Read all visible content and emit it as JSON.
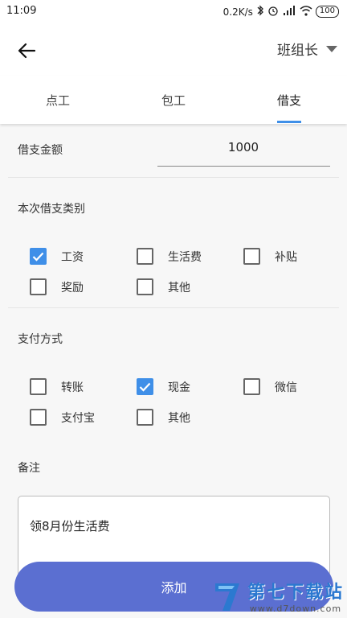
{
  "status_bar": {
    "time": "11:09",
    "network_speed": "0.2K/s",
    "battery": "100"
  },
  "header": {
    "role": "班组长"
  },
  "tabs": [
    {
      "label": "点工",
      "active": false
    },
    {
      "label": "包工",
      "active": false
    },
    {
      "label": "借支",
      "active": true
    }
  ],
  "amount": {
    "label": "借支金额",
    "value": "1000"
  },
  "loan_type": {
    "label": "本次借支类别",
    "options": [
      {
        "label": "工资",
        "checked": true
      },
      {
        "label": "生活费",
        "checked": false
      },
      {
        "label": "补贴",
        "checked": false
      },
      {
        "label": "奖励",
        "checked": false
      },
      {
        "label": "其他",
        "checked": false
      }
    ]
  },
  "payment": {
    "label": "支付方式",
    "options": [
      {
        "label": "转账",
        "checked": false
      },
      {
        "label": "现金",
        "checked": true
      },
      {
        "label": "微信",
        "checked": false
      },
      {
        "label": "支付宝",
        "checked": false
      },
      {
        "label": "其他",
        "checked": false
      }
    ]
  },
  "note": {
    "label": "备注",
    "value": "领8月份生活费"
  },
  "add_button": {
    "label": "添加"
  },
  "watermark": {
    "title": "第七下载站",
    "url": "www.d7down.com"
  },
  "colors": {
    "accent": "#3f8fe8",
    "button": "#5b6fd1",
    "background": "#f7f7f7"
  }
}
